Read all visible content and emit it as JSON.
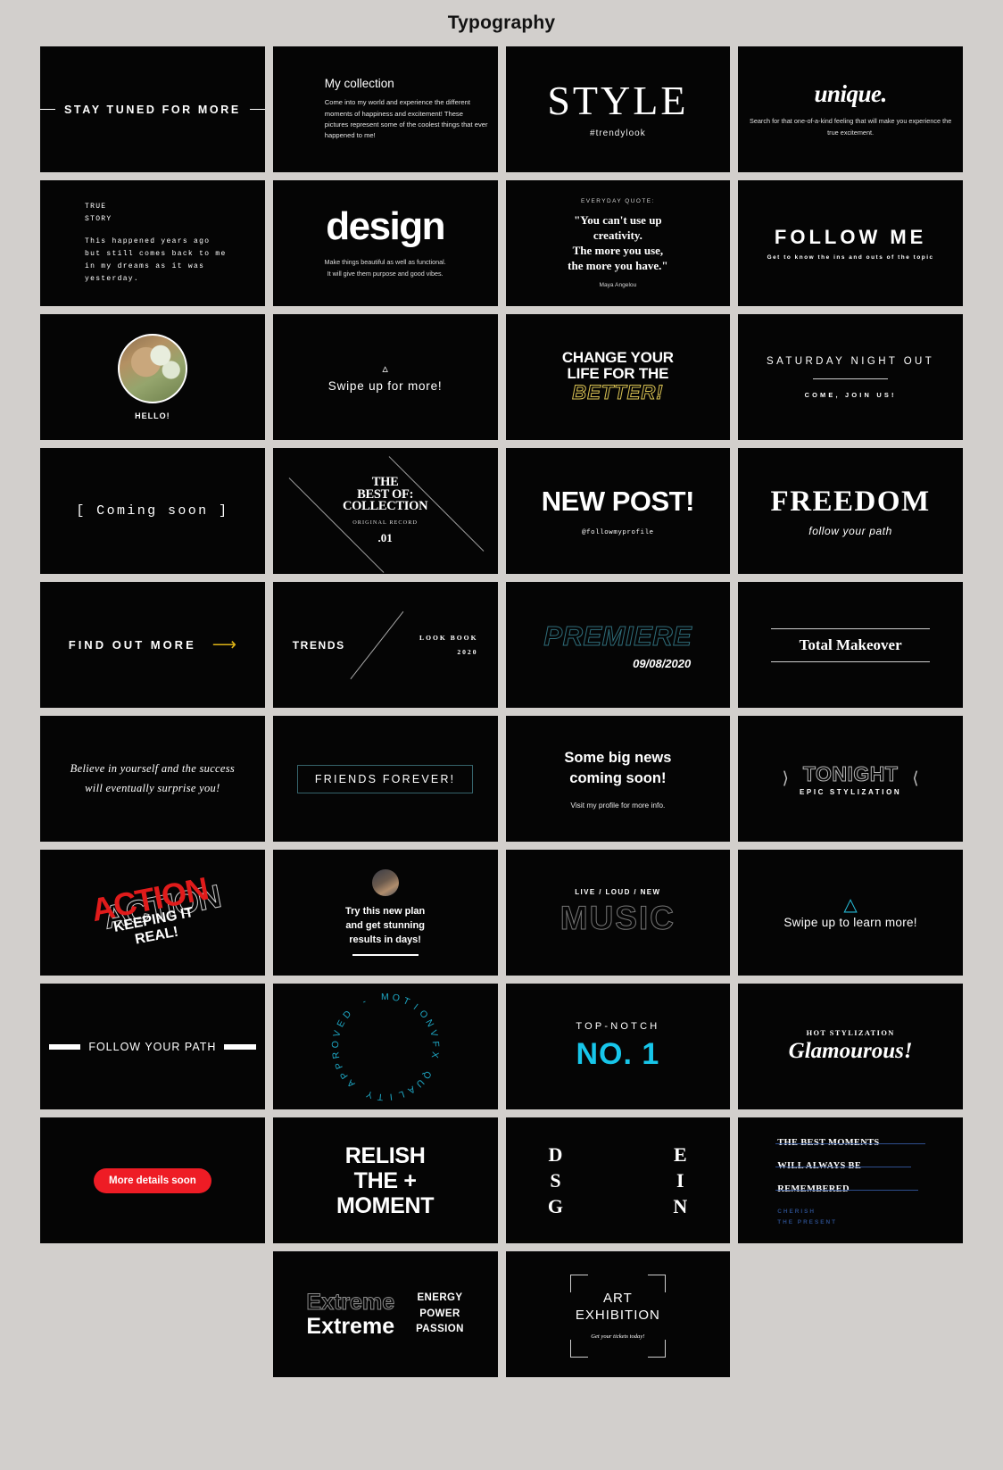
{
  "page": {
    "title": "Typography"
  },
  "colors": {
    "background": "#d2cfcc",
    "card": "#050505",
    "text": "#ffffff",
    "yellow": "#ddb316",
    "gold_stroke": "#d8c153",
    "red": "#e01b1b",
    "pill_red": "#ee1c25",
    "cyan": "#17c6ea",
    "teal": "#1ea7c4",
    "teal_stroke": "#2f6d7a",
    "blue_line": "#2f4f8f"
  },
  "cards": [
    {
      "id": "stay-tuned",
      "text": "STAY TUNED FOR MORE"
    },
    {
      "id": "my-collection",
      "heading": "My collection",
      "body": "Come into my world and experience the different moments of happiness and excitement! These pictures represent some of the coolest things that ever happened to me!"
    },
    {
      "id": "style",
      "title": "STYLE",
      "subtitle": "#trendylook"
    },
    {
      "id": "unique",
      "title": "unique.",
      "subtitle": "Search for that one-of-a-kind feeling that will make you experience the true excitement."
    },
    {
      "id": "true-story",
      "head_line1": "TRUE",
      "head_line2": "STORY",
      "body_line1": "This happened years ago",
      "body_line2": "but still comes back to me",
      "body_line3": "in my dreams as it was yesterday."
    },
    {
      "id": "design",
      "title": "design",
      "sub_line1": "Make things beautiful as well as functional.",
      "sub_line2": "It will give them purpose and good vibes."
    },
    {
      "id": "everyday-quote",
      "kicker": "EVERYDAY QUOTE:",
      "line1": "\"You can't use up",
      "line2": "creativity.",
      "line3": "The more you use,",
      "line4": "the more you have.\"",
      "author": "Maya Angelou"
    },
    {
      "id": "follow-me",
      "title": "FOLLOW ME",
      "subtitle": "Get to know the ins and outs of the topic"
    },
    {
      "id": "hello",
      "label": "HELLO!",
      "avatar": "profile-photo"
    },
    {
      "id": "swipe-up",
      "icon": "chevron-up-icon",
      "text": "Swipe up for more!"
    },
    {
      "id": "change-your-life",
      "line1": "CHANGE YOUR",
      "line2": "LIFE FOR THE",
      "line3": "BETTER!"
    },
    {
      "id": "saturday-night",
      "title": "SATURDAY NIGHT OUT",
      "subtitle": "COME, JOIN US!"
    },
    {
      "id": "coming-soon",
      "text": "[ Coming soon ]"
    },
    {
      "id": "best-of-collection",
      "line1": "THE",
      "line2": "BEST OF:",
      "line3": "COLLECTION",
      "sub": "ORIGINAL RECORD",
      "number": ".01"
    },
    {
      "id": "new-post",
      "title": "NEW POST!",
      "handle": "@followmyprofile"
    },
    {
      "id": "freedom",
      "title": "FREEDOM",
      "subtitle": "follow your path"
    },
    {
      "id": "find-out-more",
      "text": "FIND OUT MORE",
      "icon": "arrow-right-icon"
    },
    {
      "id": "trends",
      "label": "TRENDS",
      "right_line1": "LOOK BOOK",
      "right_line2": "2020"
    },
    {
      "id": "premiere",
      "title": "PREMIERE",
      "date": "09/08/2020"
    },
    {
      "id": "total-makeover",
      "title": "Total Makeover"
    },
    {
      "id": "believe",
      "line1": "Believe in yourself and the success",
      "line2": "will eventually surprise you!"
    },
    {
      "id": "friends-forever",
      "text": "FRIENDS FOREVER!"
    },
    {
      "id": "big-news",
      "line1": "Some big news",
      "line2": "coming soon!",
      "sub": "Visit my profile for more info."
    },
    {
      "id": "tonight",
      "left_icon": "chevron-right-icon",
      "right_icon": "chevron-left-icon",
      "title": "TONIGHT",
      "subtitle": "EPIC STYLIZATION"
    },
    {
      "id": "action",
      "title": "ACTION",
      "subtitle": "KEEPING IT REAL!"
    },
    {
      "id": "try-plan",
      "avatar": "profile-photo",
      "line1": "Try this new plan",
      "line2": "and get stunning",
      "line3": "results in days!"
    },
    {
      "id": "music",
      "kicker": "LIVE / LOUD / NEW",
      "title": "MUSIC"
    },
    {
      "id": "swipe-learn",
      "icon": "chevron-up-icon",
      "text": "Swipe up to learn more!"
    },
    {
      "id": "follow-your-path",
      "text": "FOLLOW YOUR PATH"
    },
    {
      "id": "motionvfx-badge",
      "text": "MOTIONVFX QUALITY APPROVED - "
    },
    {
      "id": "no-1",
      "kicker": "TOP-NOTCH",
      "number": "NO. 1"
    },
    {
      "id": "glamourous",
      "kicker": "HOT STYLIZATION",
      "title": "Glamourous!"
    },
    {
      "id": "more-details",
      "text": "More details soon"
    },
    {
      "id": "relish",
      "line1": "RELISH",
      "line2": "THE +",
      "line3": "MOMENT"
    },
    {
      "id": "design-letters",
      "letters": [
        "D",
        "E",
        "S",
        "I",
        "G",
        "N"
      ]
    },
    {
      "id": "best-moments",
      "line1": "THE BEST MOMENTS",
      "line2": "WILL ALWAYS BE",
      "line3": "REMEMBERED",
      "foot1": "CHERISH",
      "foot2": "THE PRESENT"
    },
    {
      "id": "extreme",
      "ghost": "Extreme",
      "solid": "Extreme",
      "right1": "ENERGY",
      "right2": "POWER",
      "right3": "PASSION"
    },
    {
      "id": "art-exhibition",
      "line1": "ART",
      "line2": "EXHIBITION",
      "sub": "Get your tickets today!"
    }
  ]
}
